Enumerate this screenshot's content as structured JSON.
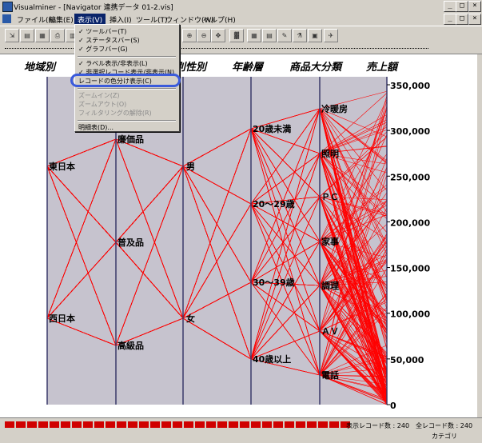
{
  "window": {
    "app_name": "Visualminer",
    "document": "[Navigator 連携データ 01-2.vis]",
    "controls_outer": [
      "_",
      "□",
      "×"
    ],
    "controls_inner": [
      "_",
      "□",
      "×"
    ]
  },
  "menubar": {
    "items": [
      "ファイル(F)",
      "編集(E)",
      "表示(V)",
      "挿入(I)",
      "ツール(T)",
      "ウィンドウ(W)",
      "ヘルプ(H)"
    ]
  },
  "toolbar": {
    "buttons": [
      "import-icon",
      "save-icon",
      "open-icon",
      "print-icon",
      "grid-icon",
      "select-icon",
      "zoom-in-icon",
      "zoom-out-icon",
      "pan-icon",
      "color-icon",
      "table-icon",
      "chart-icon",
      "brush-icon",
      "filter-icon",
      "layout-icon",
      "export-icon"
    ]
  },
  "dropdown": {
    "items": [
      {
        "label": "✓ ツールバー(T)",
        "enabled": true
      },
      {
        "label": "✓ ステータスバー(S)",
        "enabled": true
      },
      {
        "label": "✓ グラフバー(G)",
        "enabled": true
      },
      {
        "sep": true
      },
      {
        "label": "✓ ラベル表示/非表示(L)",
        "enabled": true
      },
      {
        "label": "✓ 非選択レコード表示/非表示(N)",
        "enabled": true
      },
      {
        "label": "レコードの色分け表示(C)",
        "enabled": true,
        "highlighted": true
      },
      {
        "sep": true
      },
      {
        "label": "ズームイン(Z)",
        "enabled": false
      },
      {
        "label": "ズームアウト(O)",
        "enabled": false
      },
      {
        "label": "フィルタリングの解除(R)",
        "enabled": false
      },
      {
        "sep": true
      },
      {
        "label": "明細表(D)...",
        "enabled": true
      }
    ]
  },
  "colors": {
    "axis_bg": "#c6c3ce",
    "line": "#ff0000",
    "axis": "#3a3a6a",
    "highlight_ring": "#3b5bdb",
    "selected_header_bg": "#0a246a"
  },
  "chart_data": {
    "type": "parallel_coordinates",
    "axes": [
      {
        "name": "地域別",
        "categories": [
          "東日本",
          "西日本"
        ]
      },
      {
        "name": "価格帯別",
        "categories": [
          "廉価品",
          "普及品",
          "高級品"
        ]
      },
      {
        "name": "性別",
        "categories": [
          "男",
          "女"
        ]
      },
      {
        "name": "年齢層",
        "categories": [
          "20歳未満",
          "20～29歳",
          "30～39歳",
          "40歳以上"
        ]
      },
      {
        "name": "商品大分類",
        "categories": [
          "冷暖房",
          "照明",
          "ＰＣ",
          "家事",
          "調理",
          "ＡＶ",
          "電話"
        ]
      },
      {
        "name": "売上額",
        "ticks": [
          "350,000",
          "300,000",
          "250,000",
          "200,000",
          "150,000",
          "100,000",
          "50,000",
          "0"
        ],
        "ylim": [
          0,
          350000
        ]
      }
    ],
    "records_shown": 240,
    "records_total": 240
  },
  "status": {
    "shown_label": "表示レコード数 : 240",
    "total_label": "全レコード数 : 240",
    "category_label": "カテゴリ"
  }
}
